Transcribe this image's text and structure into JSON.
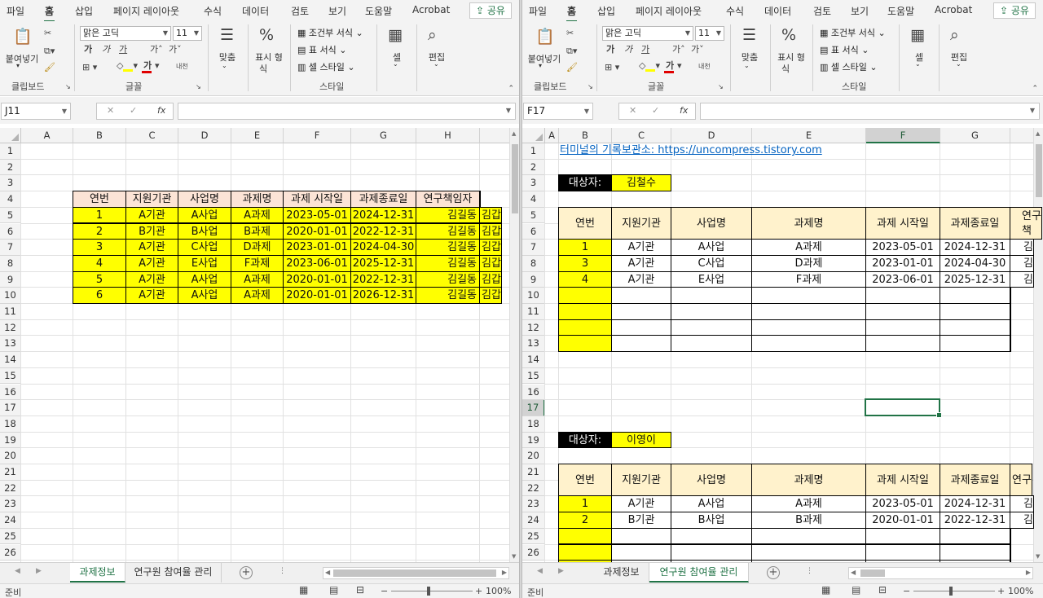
{
  "menu": [
    "파일",
    "홈",
    "삽입",
    "페이지 레이아웃",
    "수식",
    "데이터",
    "검토",
    "보기",
    "도움말",
    "Acrobat"
  ],
  "share_label": "공유",
  "ribbon": {
    "paste_label": "붙여넣기",
    "font_name": "맑은 고딕",
    "font_size": "11",
    "align_label": "맞춤",
    "number_label1": "표시 형",
    "number_label2": "식",
    "cond_format": "조건부 서식",
    "table_format": "표 서식",
    "cell_style": "셀 스타일",
    "cells_label": "셀",
    "edit_label": "편집",
    "group_clipboard": "클립보드",
    "group_font": "글꼴",
    "group_style": "스타일",
    "underline_a": "가",
    "bold": "가",
    "italic": "가",
    "under": "가",
    "grow": "가˄",
    "shrink": "가˅",
    "phonetic": "내천",
    "percent": "%"
  },
  "colors": {
    "accent": "#217346",
    "header_fill": "#fce4d6",
    "yellow": "#ffff00",
    "beige": "#fff2cc"
  },
  "left": {
    "namebox": "J11",
    "fx": "fx",
    "columns": [
      "A",
      "B",
      "C",
      "D",
      "E",
      "F",
      "G",
      "H"
    ],
    "rows": [
      "1",
      "2",
      "3",
      "4",
      "5",
      "6",
      "7",
      "8",
      "9",
      "10",
      "11",
      "12",
      "13",
      "14",
      "15",
      "16",
      "17",
      "18",
      "19",
      "20",
      "21",
      "22",
      "23",
      "24",
      "25",
      "26"
    ],
    "table_header": [
      "연번",
      "지원기관",
      "사업명",
      "과제명",
      "과제 시작일",
      "과제종료일",
      "연구책임자",
      ""
    ],
    "table_rows": [
      [
        "1",
        "A기관",
        "A사업",
        "A과제",
        "2023-05-01",
        "2024-12-31",
        "김길동",
        "김갑"
      ],
      [
        "2",
        "B기관",
        "B사업",
        "B과제",
        "2020-01-01",
        "2022-12-31",
        "김길동",
        "김갑"
      ],
      [
        "3",
        "A기관",
        "C사업",
        "D과제",
        "2023-01-01",
        "2024-04-30",
        "김길동",
        "김갑"
      ],
      [
        "4",
        "A기관",
        "E사업",
        "F과제",
        "2023-06-01",
        "2025-12-31",
        "김길동",
        "김갑"
      ],
      [
        "5",
        "A기관",
        "A사업",
        "A과제",
        "2020-01-01",
        "2022-12-31",
        "김길동",
        "김갑"
      ],
      [
        "6",
        "A기관",
        "A사업",
        "A과제",
        "2020-01-01",
        "2026-12-31",
        "김길동",
        "김갑"
      ]
    ],
    "tabs": [
      "과제정보",
      "연구원 참여율 관리"
    ],
    "active_tab": 0
  },
  "right": {
    "namebox": "F17",
    "fx": "fx",
    "columns": [
      "A",
      "B",
      "C",
      "D",
      "E",
      "F",
      "G"
    ],
    "rows": [
      "1",
      "2",
      "3",
      "4",
      "5",
      "6",
      "7",
      "8",
      "9",
      "10",
      "11",
      "12",
      "13",
      "14",
      "15",
      "16",
      "17",
      "18",
      "19",
      "20",
      "21",
      "22",
      "23",
      "24",
      "25",
      "26"
    ],
    "link_text": "터미널의 기록보관소: https://uncompress.tistory.com",
    "block1": {
      "target_label": "대상자:",
      "target_name": "김철수",
      "header": [
        "연번",
        "지원기관",
        "사업명",
        "과제명",
        "과제 시작일",
        "과제종료일",
        "연구\n책"
      ],
      "rows": [
        [
          "1",
          "A기관",
          "A사업",
          "A과제",
          "2023-05-01",
          "2024-12-31",
          "김"
        ],
        [
          "3",
          "A기관",
          "C사업",
          "D과제",
          "2023-01-01",
          "2024-04-30",
          "김"
        ],
        [
          "4",
          "A기관",
          "E사업",
          "F과제",
          "2023-06-01",
          "2025-12-31",
          "김"
        ]
      ]
    },
    "block2": {
      "target_label": "대상자:",
      "target_name": "이영이",
      "header": [
        "연번",
        "지원기관",
        "사업명",
        "과제명",
        "과제 시작일",
        "과제종료일",
        "연구"
      ],
      "rows": [
        [
          "1",
          "A기관",
          "A사업",
          "A과제",
          "2023-05-01",
          "2024-12-31",
          "김"
        ],
        [
          "2",
          "B기관",
          "B사업",
          "B과제",
          "2020-01-01",
          "2022-12-31",
          "김"
        ]
      ]
    },
    "tabs": [
      "과제정보",
      "연구원 참여율 관리"
    ],
    "active_tab": 1
  },
  "status": {
    "ready": "준비",
    "zoom": "100%",
    "minus": "−",
    "plus": "+"
  }
}
